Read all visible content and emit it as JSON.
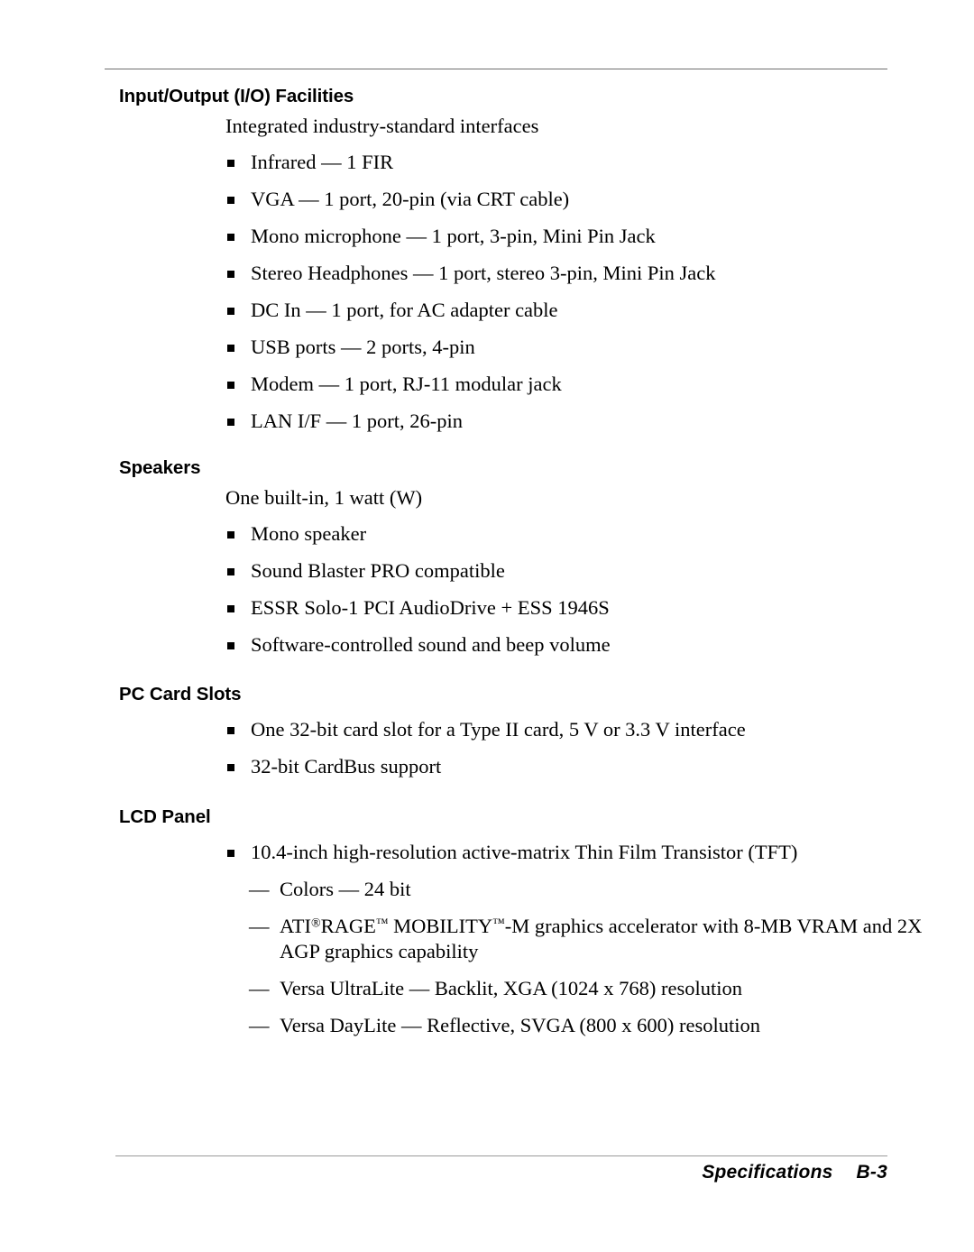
{
  "page": {
    "footer_section": "Specifications",
    "footer_page": "B-3",
    "rule_color": "#6e6e6e"
  },
  "sections": [
    {
      "heading": "Input/Output (I/O) Facilities",
      "intro": "Integrated industry-standard interfaces",
      "bullets": [
        "Infrared — 1 FIR",
        "VGA — 1 port, 20-pin (via CRT cable)",
        "Mono microphone — 1 port, 3-pin, Mini Pin Jack",
        "Stereo Headphones — 1 port, stereo 3-pin, Mini Pin Jack",
        "DC In — 1 port, for AC adapter cable",
        "USB ports — 2 ports, 4-pin",
        "Modem — 1 port, RJ-11 modular jack",
        "LAN I/F — 1 port, 26-pin"
      ]
    },
    {
      "heading": "Speakers",
      "intro": "One built-in, 1 watt (W)",
      "bullets": [
        "Mono speaker",
        "Sound Blaster PRO compatible",
        "ESSR Solo-1 PCI AudioDrive + ESS 1946S",
        "Software-controlled sound and beep volume"
      ]
    },
    {
      "heading": "PC Card Slots",
      "bullets": [
        "One 32-bit card slot for a Type II card, 5 V or 3.3 V interface",
        "32-bit CardBus support"
      ]
    },
    {
      "heading": "LCD Panel",
      "bullets": [
        "10.4-inch high-resolution active-matrix Thin Film Transistor (TFT)"
      ],
      "subitems": [
        "Colors — 24 bit",
        "ATI® RAGE™ MOBILITY™-M graphics accelerator with 8-MB VRAM and 2X AGP graphics capability",
        "Versa UltraLite — Backlit, XGA (1024 x 768) resolution",
        "Versa DayLite — Reflective, SVGA (800 x 600) resolution"
      ],
      "subitem_marker": "—",
      "ati_line": {
        "pre": "ATI",
        "reg": "®",
        "mid1": "RAGE",
        "tm1": "™",
        "mid2": " MOBILITY",
        "tm2": "™",
        "post": "-M graphics accelerator with 8-MB VRAM and 2X AGP graphics capability"
      }
    }
  ]
}
